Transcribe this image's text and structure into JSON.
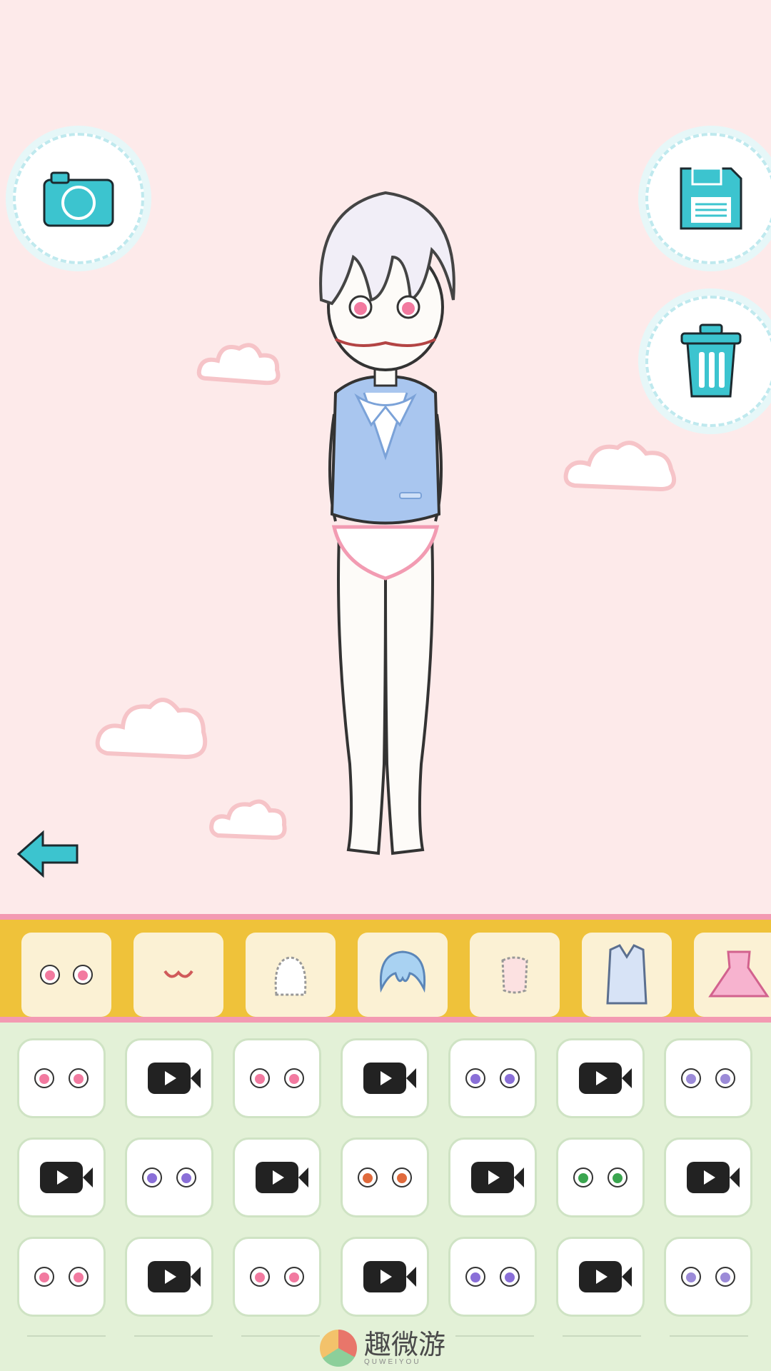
{
  "toolbar": {
    "camera_icon": "camera-icon",
    "save_icon": "save-icon",
    "trash_icon": "trash-icon",
    "back_icon": "back-arrow-icon"
  },
  "categories": [
    {
      "name": "eyes"
    },
    {
      "name": "mouth"
    },
    {
      "name": "face-shape"
    },
    {
      "name": "hair"
    },
    {
      "name": "body"
    },
    {
      "name": "top"
    },
    {
      "name": "dress"
    }
  ],
  "grid_items": [
    [
      "free",
      "video",
      "free",
      "video",
      "free",
      "video",
      "free"
    ],
    [
      "video",
      "free",
      "video",
      "free",
      "video",
      "free",
      "video"
    ],
    [
      "free",
      "video",
      "free",
      "video",
      "free",
      "video",
      "free"
    ]
  ],
  "watermark": {
    "text": "趣微游",
    "sub": "QUWEIYOU"
  },
  "colors": {
    "accent": "#3cc4cf",
    "category_bar": "#efc23a",
    "category_border": "#f39ab2",
    "grid_bg": "#e3f1d7",
    "scene_bg": "#fdeaea"
  }
}
